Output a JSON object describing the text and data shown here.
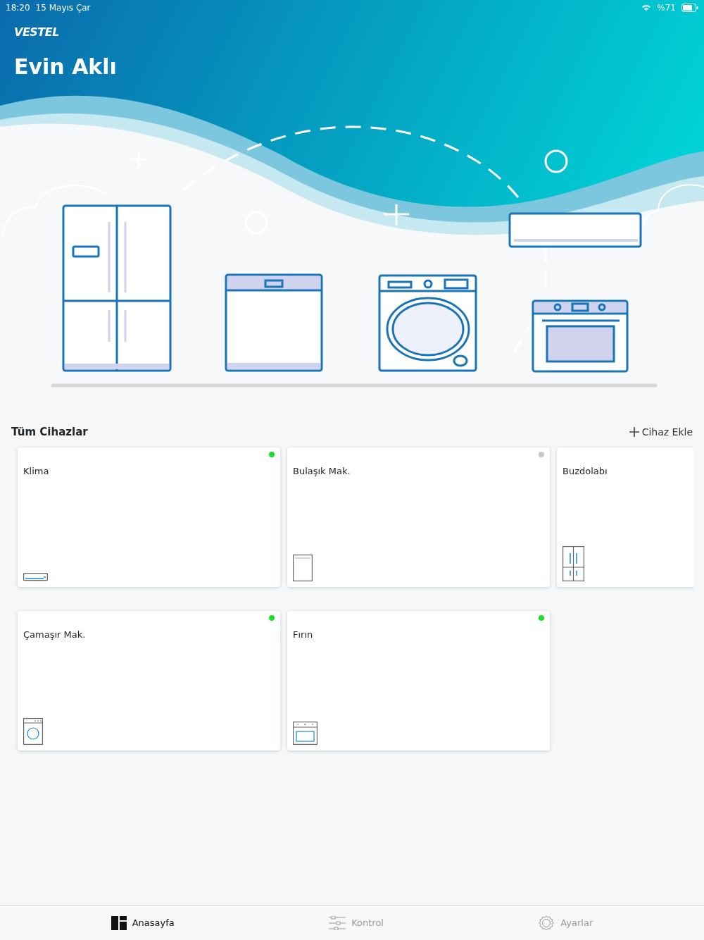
{
  "status_bar": {
    "time": "18:20",
    "date": "15 Mayıs Çar",
    "battery": "%71"
  },
  "header": {
    "brand": "VESTEL",
    "title": "Evin Aklı"
  },
  "section": {
    "title": "Tüm Cihazlar",
    "add_button": "Cihaz Ekle"
  },
  "devices": [
    {
      "name": "Klima",
      "kind": "ac",
      "online": true
    },
    {
      "name": "Bulaşık Mak.",
      "kind": "dishwasher",
      "online": false
    },
    {
      "name": "Buzdolabı",
      "kind": "fridge"
    },
    {
      "name": "Çamaşır Mak.",
      "kind": "washer",
      "online": true
    },
    {
      "name": "Fırın",
      "kind": "oven",
      "online": true
    }
  ],
  "tabs": [
    {
      "label": "Anasayfa",
      "kind": "home",
      "selected": true
    },
    {
      "label": "Kontrol",
      "kind": "control",
      "selected": false
    },
    {
      "label": "Ayarlar",
      "kind": "settings",
      "selected": false
    }
  ]
}
